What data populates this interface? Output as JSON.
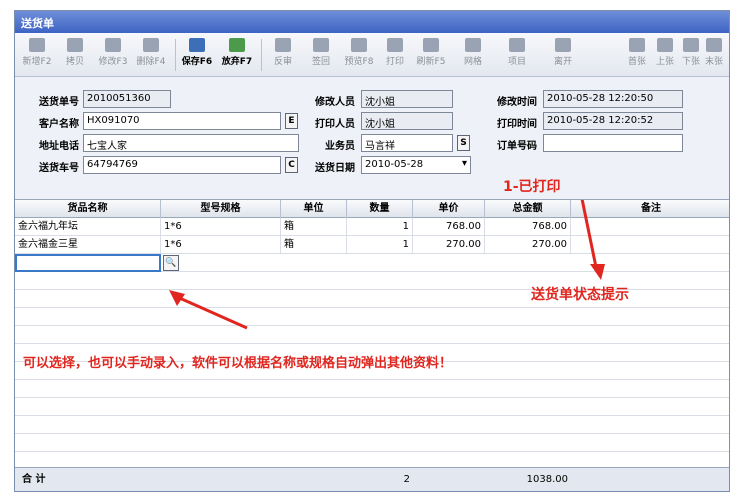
{
  "window": {
    "title": "送货单"
  },
  "toolbar": {
    "items": [
      {
        "label": "新增F2",
        "icon": "new-icon",
        "enabled": false
      },
      {
        "label": "拷贝",
        "icon": "copy-icon",
        "enabled": false
      },
      {
        "label": "修改F3",
        "icon": "edit-icon",
        "enabled": false
      },
      {
        "label": "删除F4",
        "icon": "delete-icon",
        "enabled": false
      },
      {
        "label": "保存F6",
        "icon": "save-icon",
        "enabled": true
      },
      {
        "label": "放弃F7",
        "icon": "undo-icon",
        "enabled": true
      },
      {
        "label": "反审",
        "icon": "unapprove-icon",
        "enabled": false
      },
      {
        "label": "签回",
        "icon": "signback-icon",
        "enabled": false
      },
      {
        "label": "预览F8",
        "icon": "preview-icon",
        "enabled": false
      },
      {
        "label": "打印",
        "icon": "print-icon",
        "enabled": false
      },
      {
        "label": "刷新F5",
        "icon": "refresh-icon",
        "enabled": false
      },
      {
        "label": "网格",
        "icon": "grid-icon",
        "enabled": false
      },
      {
        "label": "项目",
        "icon": "item-icon",
        "enabled": false
      },
      {
        "label": "离开",
        "icon": "exit-icon",
        "enabled": false
      },
      {
        "label": "首张",
        "icon": "first-icon",
        "enabled": false
      },
      {
        "label": "上张",
        "icon": "prev-icon",
        "enabled": false
      },
      {
        "label": "下张",
        "icon": "next-icon",
        "enabled": false
      },
      {
        "label": "末张",
        "icon": "last-icon",
        "enabled": false
      }
    ]
  },
  "form": {
    "order_no_label": "送货单号",
    "order_no": "2010051360",
    "customer_label": "客户名称",
    "customer": "HX091070",
    "address_label": "地址电话",
    "address": "七宝人家",
    "vehicle_label": "送货车号",
    "vehicle": "64794769",
    "modifier_label": "修改人员",
    "modifier": "沈小姐",
    "printer_label": "打印人员",
    "printer": "沈小姐",
    "salesman_label": "业务员",
    "salesman": "马言祥",
    "date_label": "送货日期",
    "date": "2010-05-28",
    "mod_time_label": "修改时间",
    "mod_time": "2010-05-28 12:20:50",
    "print_time_label": "打印时间",
    "print_time": "2010-05-28 12:20:52",
    "order_ref_label": "订单号码",
    "order_ref": ""
  },
  "grid": {
    "headers": [
      "货品名称",
      "型号规格",
      "单位",
      "数量",
      "单价",
      "总金额",
      "备注"
    ],
    "rows": [
      {
        "name": "金六福九年坛",
        "spec": "1*6",
        "unit": "箱",
        "qty": "1",
        "price": "768.00",
        "amount": "768.00",
        "note": ""
      },
      {
        "name": "金六福金三星",
        "spec": "1*6",
        "unit": "箱",
        "qty": "1",
        "price": "270.00",
        "amount": "270.00",
        "note": ""
      }
    ]
  },
  "footer": {
    "total_label": "合 计",
    "total_qty": "2",
    "total_amount": "1038.00"
  },
  "annotations": {
    "printed": "1-已打印",
    "status_hint": "送货单状态提示",
    "input_hint": "可以选择，也可以手动录入，软件可以根据名称或规格自动弹出其他资料！"
  },
  "colors": {
    "annotation": "#e0261f",
    "titlebar": "#3d63c4"
  }
}
